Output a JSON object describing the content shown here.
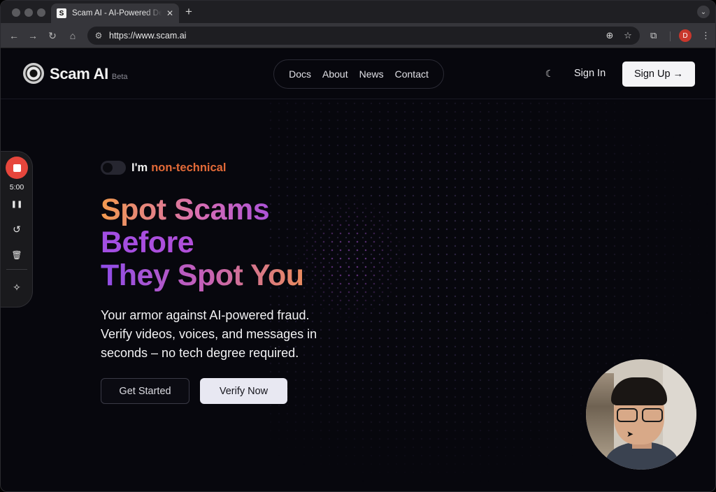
{
  "browser": {
    "tab": {
      "favicon": "S",
      "title": "Scam AI - AI-Powered Deepfake Detection",
      "close": "✕"
    },
    "new_tab": "+",
    "tab_search": "⌄",
    "nav": {
      "back": "←",
      "forward": "→",
      "reload": "↻",
      "home": "⌂"
    },
    "url": "https://www.scam.ai",
    "omnibox_icons": {
      "tune": "⚙",
      "zoom": "⊕",
      "bookmark": "☆"
    },
    "extensions": "⧉",
    "profile_initial": "D",
    "menu": "⋮"
  },
  "site": {
    "logo_text": "Scam AI",
    "logo_badge": "Beta",
    "nav": [
      "Docs",
      "About",
      "News",
      "Contact"
    ],
    "theme_icon": "☾",
    "signin": "Sign In",
    "signup": "Sign Up →"
  },
  "hero": {
    "toggle_prefix": "I'm",
    "toggle_accent": "non-technical",
    "headline": [
      "Spot Scams",
      "Before",
      "They Spot You"
    ],
    "subcopy": [
      "Your armor against AI-powered fraud.",
      "Verify videos, voices, and messages in",
      "seconds – no tech degree required."
    ],
    "cta_primary": "Get Started",
    "cta_secondary": "Verify Now"
  },
  "recorder": {
    "time": "5:00",
    "pause": "❚❚",
    "restart": "↺",
    "delete": "🗑",
    "effects": "✧"
  },
  "colors": {
    "accent_orange": "#e36a38",
    "gradient_purple": "#a04ee3",
    "record_red": "#e6463c"
  }
}
